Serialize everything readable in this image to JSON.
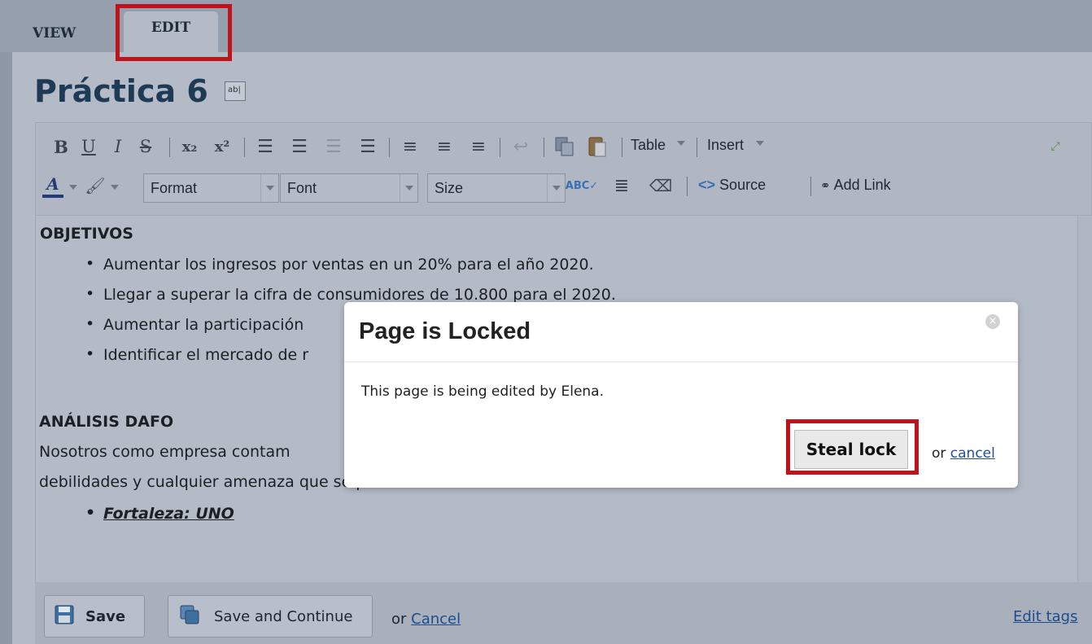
{
  "tabs": {
    "view": "VIEW",
    "edit": "EDIT"
  },
  "page": {
    "title": "Práctica 6",
    "rename_icon_text": "ab|"
  },
  "toolbar": {
    "row1": [
      "B",
      "U",
      "I",
      "S",
      "x₂",
      "x²"
    ],
    "table_label": "Table",
    "insert_label": "Insert",
    "format_label": "Format",
    "font_label": "Font",
    "size_label": "Size",
    "source_label": "Source",
    "add_link_label": "Add Link"
  },
  "content": {
    "heading1": "OBJETIVOS",
    "bullets": [
      "Aumentar los ingresos por ventas en un 20% para el año 2020.",
      "Llegar a superar la cifra de consumidores de 10.800 para el 2020.",
      "Aumentar la participación",
      "Identificar el mercado de r"
    ],
    "heading2": "ANÁLISIS DAFO",
    "para_line1": "Nosotros como empresa contam",
    "para_line2": "debilidades y cualquier amenaza que se presente.",
    "fortaleza": "Fortaleza: UNO"
  },
  "footer": {
    "save_label": "Save",
    "save_continue_label": "Save and Continue",
    "or_text": "or",
    "cancel_label": "Cancel",
    "edit_tags_label": "Edit tags"
  },
  "modal": {
    "title": "Page is Locked",
    "message": "This page is being edited by Elena.",
    "steal_lock_label": "Steal lock",
    "or_text": "or",
    "cancel_label": "cancel"
  },
  "colors": {
    "highlight_red": "#c0121b",
    "title_blue": "#1f3a55",
    "link_blue": "#1c4d8c"
  }
}
